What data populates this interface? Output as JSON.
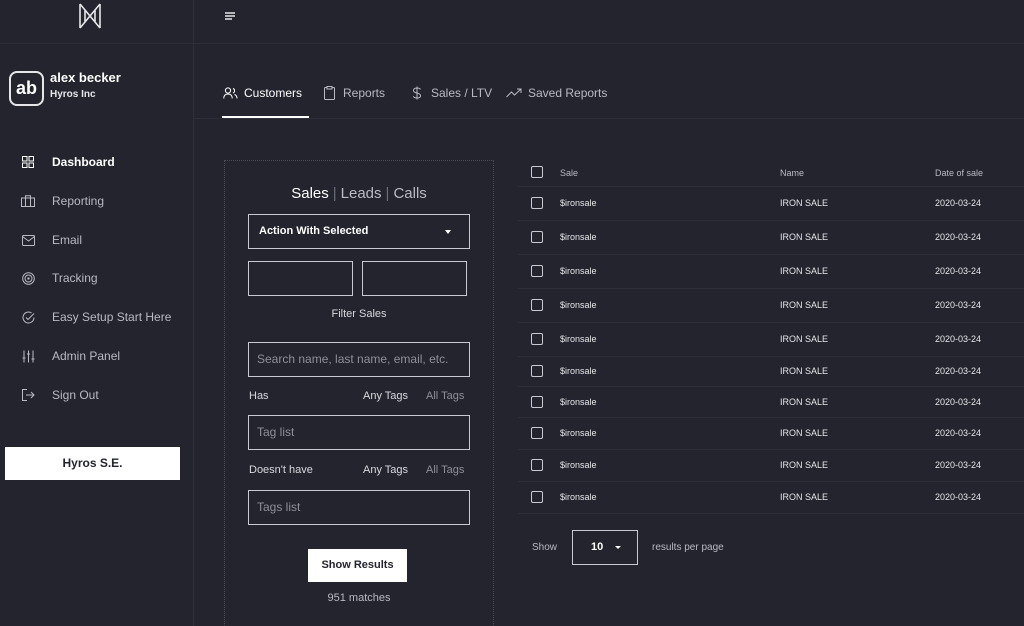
{
  "user": {
    "avatar_initials": "ab",
    "name": "alex becker",
    "org": "Hyros Inc"
  },
  "sidebar": {
    "items": [
      {
        "label": "Dashboard",
        "icon": "grid-icon"
      },
      {
        "label": "Reporting",
        "icon": "briefcase-icon"
      },
      {
        "label": "Email",
        "icon": "mail-icon"
      },
      {
        "label": "Tracking",
        "icon": "target-icon"
      },
      {
        "label": "Easy Setup Start Here",
        "icon": "check-circle-icon"
      },
      {
        "label": "Admin Panel",
        "icon": "sliders-icon"
      },
      {
        "label": "Sign Out",
        "icon": "sign-out-icon"
      }
    ],
    "se_button": "Hyros S.E."
  },
  "tabs": [
    {
      "label": "Customers",
      "icon": "users-icon"
    },
    {
      "label": "Reports",
      "icon": "clipboard-icon"
    },
    {
      "label": "Sales / LTV",
      "icon": "dollar-icon"
    },
    {
      "label": "Saved Reports",
      "icon": "trending-up-icon"
    }
  ],
  "filter": {
    "segments": [
      "Sales",
      "Leads",
      "Calls"
    ],
    "action_select": "Action With Selected",
    "filter_label": "Filter Sales",
    "search_placeholder": "Search name, last name, email, etc.",
    "has_label": "Has",
    "doesnt_have_label": "Doesn't have",
    "any_tags": "Any Tags",
    "all_tags": "All Tags",
    "tag_list_placeholder": "Tag list",
    "tags_list_placeholder": "Tags list",
    "show_results": "Show Results",
    "matches": "951 matches"
  },
  "table": {
    "columns": [
      "Sale",
      "Name",
      "Date of sale"
    ],
    "rows": [
      [
        "$ironsale",
        "IRON SALE",
        "2020-03-24"
      ],
      [
        "$ironsale",
        "IRON SALE",
        "2020-03-24"
      ],
      [
        "$ironsale",
        "IRON SALE",
        "2020-03-24"
      ],
      [
        "$ironsale",
        "IRON SALE",
        "2020-03-24"
      ],
      [
        "$ironsale",
        "IRON SALE",
        "2020-03-24"
      ],
      [
        "$ironsale",
        "IRON SALE",
        "2020-03-24"
      ],
      [
        "$ironsale",
        "IRON SALE",
        "2020-03-24"
      ],
      [
        "$ironsale",
        "IRON SALE",
        "2020-03-24"
      ],
      [
        "$ironsale",
        "IRON SALE",
        "2020-03-24"
      ],
      [
        "$ironsale",
        "IRON SALE",
        "2020-03-24"
      ]
    ]
  },
  "pager": {
    "show_label": "Show",
    "per_page": "10",
    "suffix": "results per page"
  },
  "colors": {
    "background": "#23242e",
    "text": "#d8d9de",
    "accent": "#ffffff"
  }
}
